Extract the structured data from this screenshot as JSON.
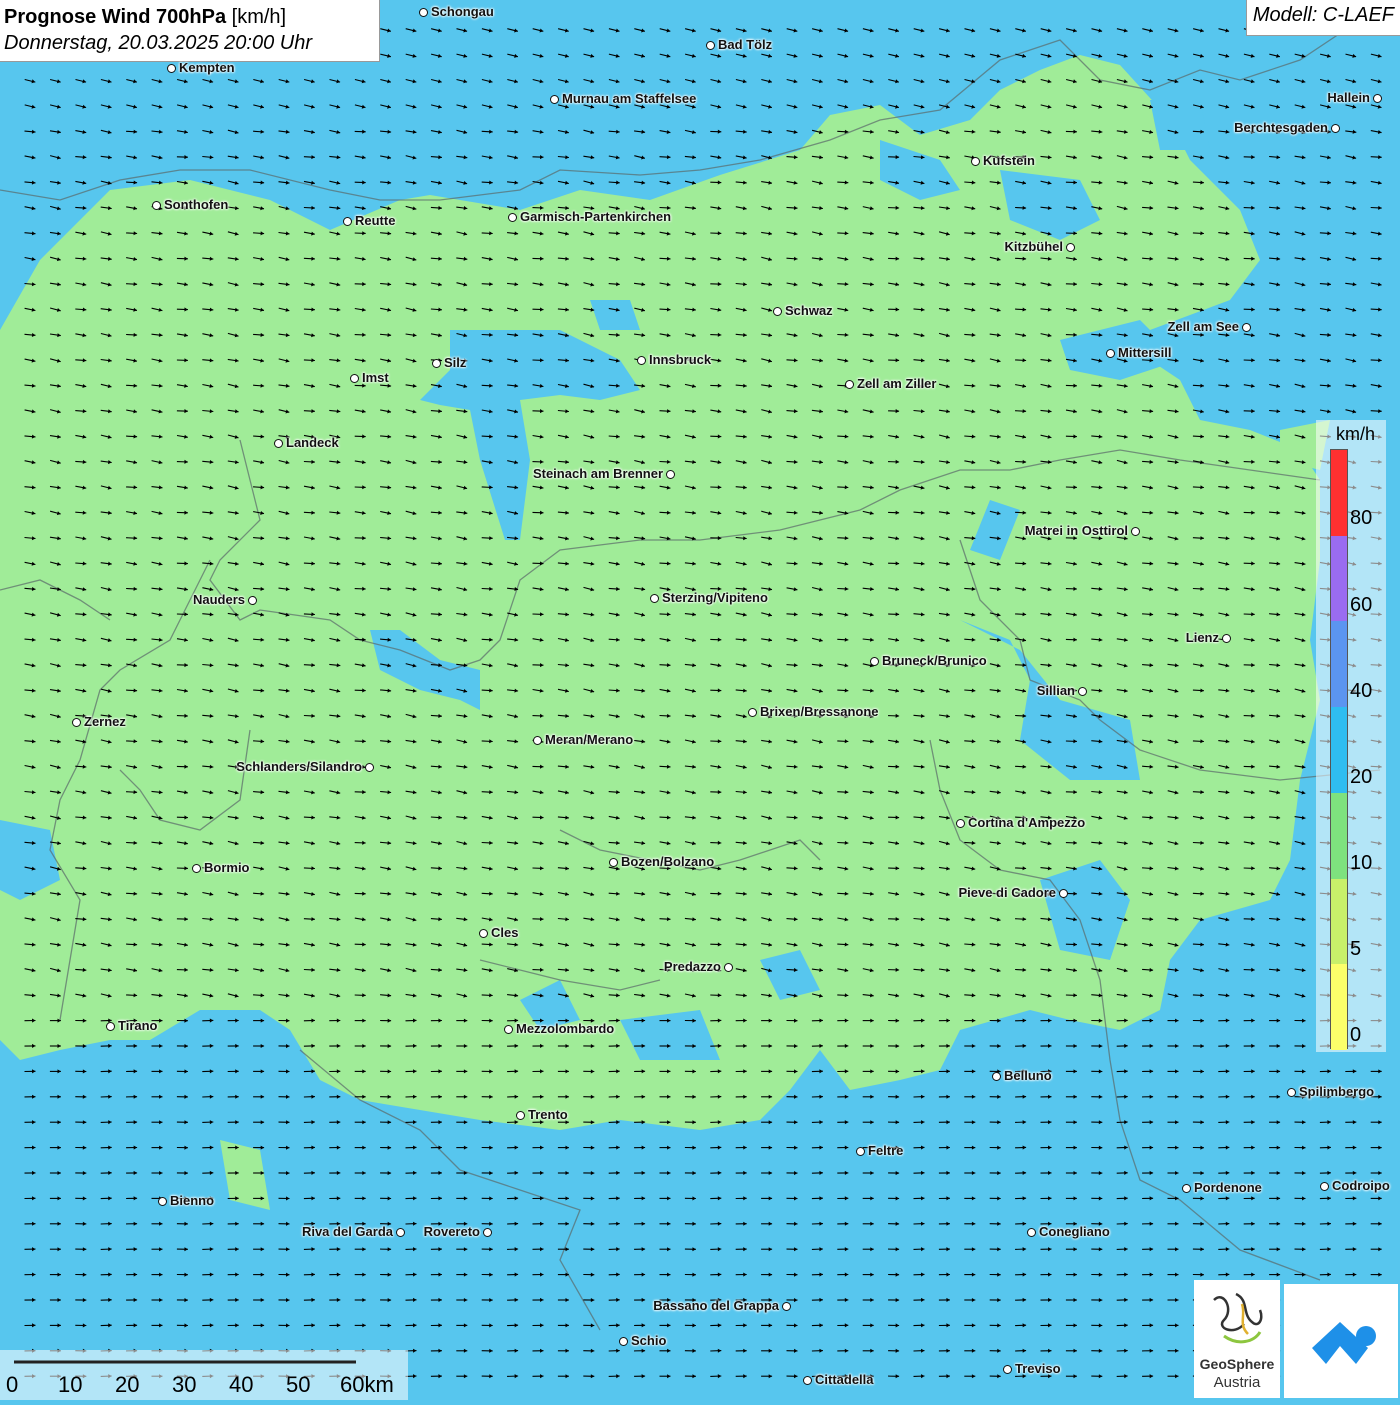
{
  "header": {
    "title_bold": "Prognose Wind 700hPa",
    "title_unit": "[km/h]",
    "datetime": "Donnerstag, 20.03.2025 20:00 Uhr",
    "model": "Modell: C-LAEF"
  },
  "legend": {
    "unit": "km/h",
    "labels": [
      "80",
      "60",
      "40",
      "20",
      "10",
      "5",
      "0"
    ],
    "colors": [
      "#ff3030",
      "#9a6cf0",
      "#5b95f0",
      "#2fbdf0",
      "#7ee27e",
      "#c8f06a",
      "#fcff6a"
    ]
  },
  "scale": {
    "labels": [
      "0",
      "10",
      "20",
      "30",
      "40",
      "50",
      "60km"
    ]
  },
  "logos": {
    "geosphere_name": "GeoSphere",
    "geosphere_sub": "Austria"
  },
  "colors": {
    "water_blue": "#57c6ee",
    "wind_green": "#a0ec98",
    "arrow": "#000000"
  },
  "cities": [
    {
      "name": "Schongau"
    },
    {
      "name": "Bad Tölz"
    },
    {
      "name": "Kempten"
    },
    {
      "name": "Murnau am Staffelsee"
    },
    {
      "name": "Hallein"
    },
    {
      "name": "Berchtesgaden"
    },
    {
      "name": "Kufstein"
    },
    {
      "name": "Sonthofen"
    },
    {
      "name": "Reutte"
    },
    {
      "name": "Garmisch-Partenkirchen"
    },
    {
      "name": "Kitzbühel"
    },
    {
      "name": "Schwaz"
    },
    {
      "name": "Zell am See"
    },
    {
      "name": "Mittersill"
    },
    {
      "name": "Innsbruck"
    },
    {
      "name": "Silz"
    },
    {
      "name": "Imst"
    },
    {
      "name": "Zell am Ziller"
    },
    {
      "name": "Landeck"
    },
    {
      "name": "Steinach am Brenner"
    },
    {
      "name": "Matrei in Osttirol"
    },
    {
      "name": "Nauders"
    },
    {
      "name": "Sterzing/Vipiteno"
    },
    {
      "name": "Lienz"
    },
    {
      "name": "Bruneck/Brunico"
    },
    {
      "name": "Sillian"
    },
    {
      "name": "Brixen/Bressanone"
    },
    {
      "name": "Zernez"
    },
    {
      "name": "Meran/Merano"
    },
    {
      "name": "Schlanders/Silandro"
    },
    {
      "name": "Cortina d'Ampezzo"
    },
    {
      "name": "Bozen/Bolzano"
    },
    {
      "name": "Bormio"
    },
    {
      "name": "Pieve di Cadore"
    },
    {
      "name": "Cles"
    },
    {
      "name": "Predazzo"
    },
    {
      "name": "Tirano"
    },
    {
      "name": "Mezzolombardo"
    },
    {
      "name": "Belluno"
    },
    {
      "name": "Spilimbergo"
    },
    {
      "name": "Trento"
    },
    {
      "name": "Feltre"
    },
    {
      "name": "Pordenone"
    },
    {
      "name": "Codroipo"
    },
    {
      "name": "Bienno"
    },
    {
      "name": "Riva del Garda"
    },
    {
      "name": "Rovereto"
    },
    {
      "name": "Conegliano"
    },
    {
      "name": "Bassano del Grappa"
    },
    {
      "name": "Schio"
    },
    {
      "name": "Treviso"
    },
    {
      "name": "Cittadella"
    }
  ]
}
